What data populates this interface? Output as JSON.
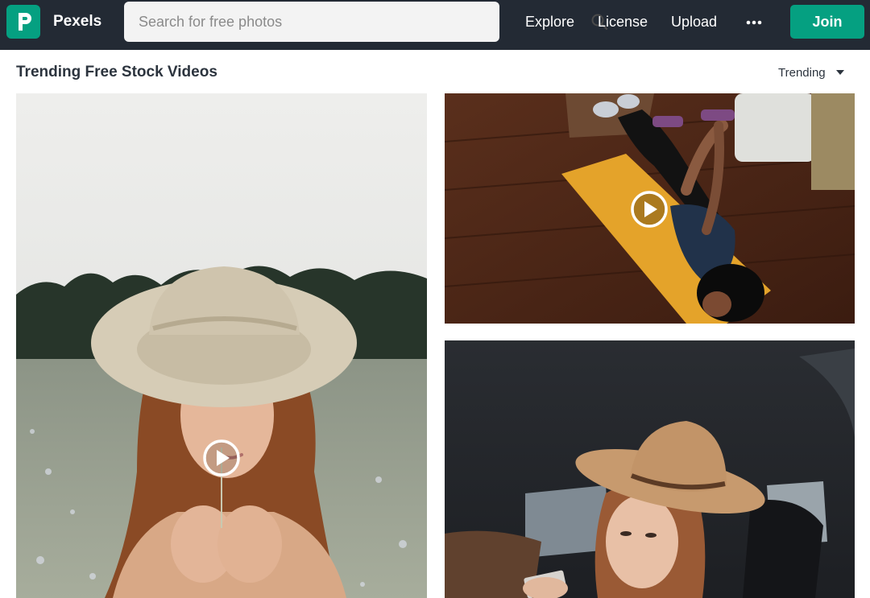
{
  "brand": {
    "name": "Pexels",
    "color": "#05a081"
  },
  "search": {
    "placeholder": "Search for free photos",
    "icon": "search-icon"
  },
  "nav": {
    "links": [
      "Explore",
      "License",
      "Upload"
    ],
    "more_icon": "more-horizontal-icon",
    "join_label": "Join"
  },
  "section": {
    "title": "Trending Free Stock Videos",
    "sort_label": "Trending",
    "sort_icon": "caret-down-icon"
  },
  "videos": [
    {
      "subject": "woman in wide-brimmed hat holding flower in meadow",
      "icon": "play-icon"
    },
    {
      "subject": "person doing dumbbell exercise on yellow yoga mat",
      "icon": "play-icon"
    },
    {
      "subject": "woman in tan fedora hat inside car",
      "icon": "play-icon"
    }
  ],
  "colors": {
    "navbar": "#232a34",
    "accent": "#05a081",
    "title_text": "#2c343e"
  }
}
